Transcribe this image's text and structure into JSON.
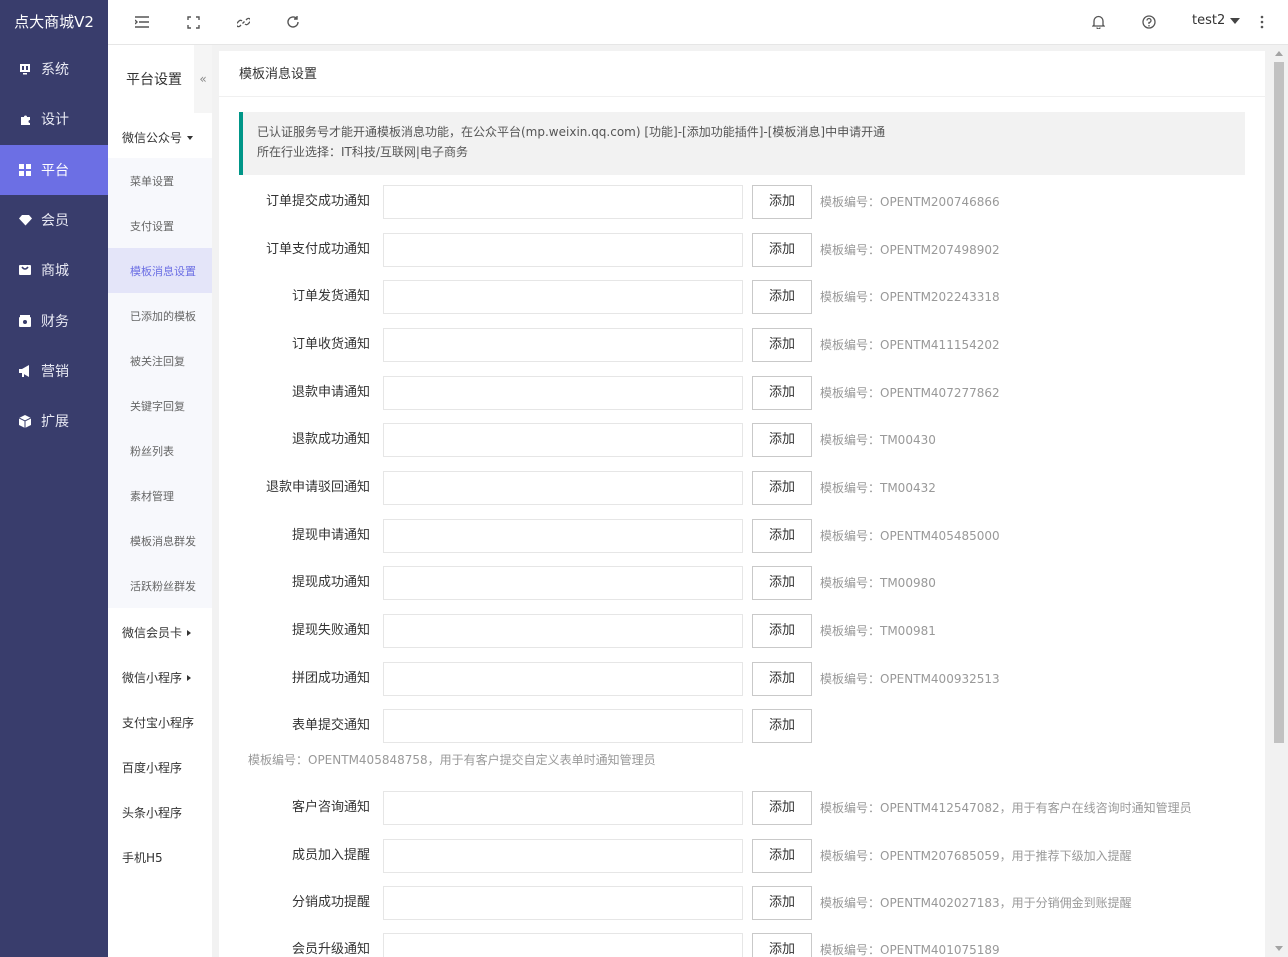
{
  "app": {
    "logo": "点大商城V2"
  },
  "nav": [
    {
      "label": "系统",
      "icon": "monitor-icon"
    },
    {
      "label": "设计",
      "icon": "puzzle-icon"
    },
    {
      "label": "平台",
      "icon": "grid-icon",
      "active": true
    },
    {
      "label": "会员",
      "icon": "diamond-icon"
    },
    {
      "label": "商城",
      "icon": "shop-icon"
    },
    {
      "label": "财务",
      "icon": "wallet-icon"
    },
    {
      "label": "营销",
      "icon": "megaphone-icon"
    },
    {
      "label": "扩展",
      "icon": "cube-icon"
    }
  ],
  "topbar": {
    "user": "test2"
  },
  "subnav": {
    "title": "平台设置",
    "collapse": "«",
    "groups": [
      {
        "label": "微信公众号",
        "arrow": "down"
      },
      {
        "label": "微信会员卡",
        "arrow": "right"
      },
      {
        "label": "微信小程序",
        "arrow": "right"
      },
      {
        "label": "支付宝小程序"
      },
      {
        "label": "百度小程序"
      },
      {
        "label": "头条小程序"
      },
      {
        "label": "手机H5"
      }
    ],
    "items": [
      {
        "label": "菜单设置"
      },
      {
        "label": "支付设置"
      },
      {
        "label": "模板消息设置",
        "active": true
      },
      {
        "label": "已添加的模板"
      },
      {
        "label": "被关注回复"
      },
      {
        "label": "关键字回复"
      },
      {
        "label": "粉丝列表"
      },
      {
        "label": "素材管理"
      },
      {
        "label": "模板消息群发"
      },
      {
        "label": "活跃粉丝群发"
      }
    ]
  },
  "main": {
    "title": "模板消息设置",
    "notice_line1": "已认证服务号才能开通模板消息功能，在公众平台(mp.weixin.qq.com) [功能]-[添加功能插件]-[模板消息]中申请开通",
    "notice_line2": "所在行业选择：IT科技/互联网|电子商务",
    "add_label": "添加",
    "rows": [
      {
        "label": "订单提交成功通知",
        "value": "",
        "tip": "模板编号：OPENTM200746866"
      },
      {
        "label": "订单支付成功通知",
        "value": "",
        "tip": "模板编号：OPENTM207498902"
      },
      {
        "label": "订单发货通知",
        "value": "",
        "tip": "模板编号：OPENTM202243318"
      },
      {
        "label": "订单收货通知",
        "value": "",
        "tip": "模板编号：OPENTM411154202"
      },
      {
        "label": "退款申请通知",
        "value": "",
        "tip": "模板编号：OPENTM407277862"
      },
      {
        "label": "退款成功通知",
        "value": "",
        "tip": "模板编号：TM00430"
      },
      {
        "label": "退款申请驳回通知",
        "value": "",
        "tip": "模板编号：TM00432"
      },
      {
        "label": "提现申请通知",
        "value": "",
        "tip": "模板编号：OPENTM405485000"
      },
      {
        "label": "提现成功通知",
        "value": "",
        "tip": "模板编号：TM00980"
      },
      {
        "label": "提现失败通知",
        "value": "",
        "tip": "模板编号：TM00981"
      },
      {
        "label": "拼团成功通知",
        "value": "",
        "tip": "模板编号：OPENTM400932513"
      },
      {
        "label": "表单提交通知",
        "value": "",
        "tip": ""
      },
      {
        "label": "客户咨询通知",
        "value": "",
        "tip": "模板编号：OPENTM412547082，用于有客户在线咨询时通知管理员"
      },
      {
        "label": "成员加入提醒",
        "value": "",
        "tip": "模板编号：OPENTM207685059，用于推荐下级加入提醒"
      },
      {
        "label": "分销成功提醒",
        "value": "",
        "tip": "模板编号：OPENTM402027183，用于分销佣金到账提醒"
      },
      {
        "label": "会员升级通知",
        "value": "",
        "tip": "模板编号：OPENTM401075189"
      }
    ],
    "form_tip": "模板编号：OPENTM405848758，用于有客户提交自定义表单时通知管理员"
  }
}
